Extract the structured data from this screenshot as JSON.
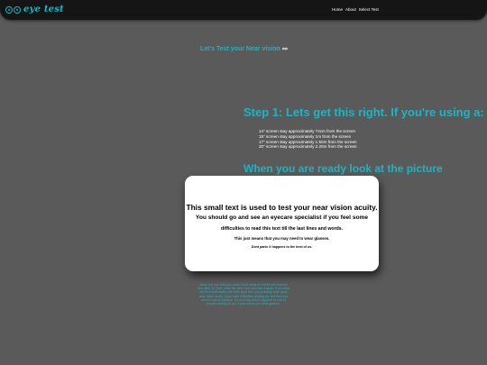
{
  "navbar": {
    "logo_text": "eye test",
    "links": [
      "Home",
      "About",
      "Select Test"
    ]
  },
  "intro": {
    "text": "Let's Test your Near vision",
    "icon": "eyes-icon"
  },
  "step1": {
    "heading": "Step 1: Lets get this right. If you're using a:",
    "screens": [
      "14\" screen stay approximately 74cm from the screen",
      "15\" screen stay approximately 1m from the screen",
      "17\" screen stay approximately 1.50m from the screen",
      "20\" screen stay approximately 2.20m from the screen"
    ]
  },
  "ready": {
    "heading": "When you are ready look at the picture"
  },
  "card": {
    "line1": "This small text is used to test your near vision acuity.",
    "line2": "You should go and see an eyecare specialist if you feel some",
    "line3": "difficulties to read this text till the last lines and words.",
    "line4": "This just means that you may need to wear glasses.",
    "line5": "Dont panic it happens to the best of us."
  },
  "note": {
    "text": "Close one eye with your palm. Don't press on the lid and read the text, after 1s, then, close the other eye and read it again. If you read the text comfortably with both eyes then you probably have good near vision acuity. If you have difficulties reading the text then you need to see an optician. It's not a big deal it happens to a lot of people starting 40 y.o. It just means you need glasses."
  },
  "colors": {
    "accent": "#1fb3c4",
    "background": "#5a5a5a",
    "navbar": "#151515",
    "card": "#ffffff"
  }
}
